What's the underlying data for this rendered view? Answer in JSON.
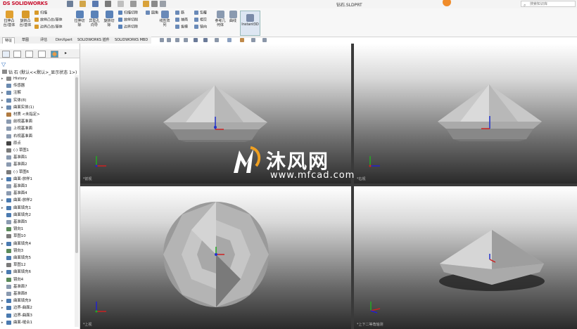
{
  "app": {
    "logo_ds": "DS",
    "logo_text": "SOLIDWORKS",
    "doc_title": "钻石.SLDPRT",
    "search_placeholder": "搜索知识库"
  },
  "ribbon": {
    "big_buttons": [
      {
        "label": "拉伸凸\n台/基体"
      },
      {
        "label": "旋转凸\n台/基体"
      },
      {
        "label": "拉伸切\n除"
      },
      {
        "label": "异型孔\n向导"
      },
      {
        "label": "旋转切\n除"
      },
      {
        "label": "线性阵\n列"
      },
      {
        "label": "参考几\n何体"
      },
      {
        "label": "曲线"
      },
      {
        "label": "Instant3D"
      }
    ],
    "small_buttons": [
      "扫描",
      "放样凸台/基体",
      "边界凸台/基体",
      "扫描切除",
      "放样切削",
      "边界切除",
      "圆角",
      "筋",
      "抽壳",
      "拔模",
      "包覆",
      "相交",
      "镜向"
    ]
  },
  "tabs": [
    "特征",
    "草图",
    "评估",
    "DimXpert",
    "SOLIDWORKS 插件",
    "SOLIDWORKS MBD"
  ],
  "tree": {
    "root": "钻 石 (默认<<默认>_显示状态 1>)",
    "items": [
      {
        "label": "History",
        "arrow": "▸",
        "color": "#8a8a8a"
      },
      {
        "label": "传感器",
        "arrow": "",
        "color": "#6a8ab0"
      },
      {
        "label": "注解",
        "arrow": "▸",
        "color": "#6a8ab0"
      },
      {
        "label": "实体(8)",
        "arrow": "▸",
        "color": "#6a8ab0"
      },
      {
        "label": "曲面实体(1)",
        "arrow": "▸",
        "color": "#6a8ab0"
      },
      {
        "label": "材质 <未指定>",
        "arrow": "",
        "color": "#b07a40"
      },
      {
        "label": "前视基准面",
        "arrow": "",
        "color": "#8a9ab0"
      },
      {
        "label": "上视基准面",
        "arrow": "",
        "color": "#8a9ab0"
      },
      {
        "label": "右视基准面",
        "arrow": "",
        "color": "#8a9ab0"
      },
      {
        "label": "原点",
        "arrow": "",
        "color": "#444444"
      },
      {
        "label": "(-) 草图1",
        "arrow": "",
        "color": "#7a7a7a"
      },
      {
        "label": "基准面1",
        "arrow": "",
        "color": "#8a9ab0"
      },
      {
        "label": "基准面2",
        "arrow": "",
        "color": "#8a9ab0"
      },
      {
        "label": "(-) 草图6",
        "arrow": "",
        "color": "#7a7a7a"
      },
      {
        "label": "曲面-放样1",
        "arrow": "▸",
        "color": "#4a7ab0"
      },
      {
        "label": "基准面3",
        "arrow": "",
        "color": "#8a9ab0"
      },
      {
        "label": "基准面4",
        "arrow": "",
        "color": "#8a9ab0"
      },
      {
        "label": "曲面-放样2",
        "arrow": "▸",
        "color": "#4a7ab0"
      },
      {
        "label": "曲面填充1",
        "arrow": "▸",
        "color": "#4a7ab0"
      },
      {
        "label": "曲面填充2",
        "arrow": "",
        "color": "#4a7ab0"
      },
      {
        "label": "基准面5",
        "arrow": "",
        "color": "#8a9ab0"
      },
      {
        "label": "镜向1",
        "arrow": "",
        "color": "#5a8a5a"
      },
      {
        "label": "草图10",
        "arrow": "",
        "color": "#7a7a7a"
      },
      {
        "label": "曲面填充4",
        "arrow": "▸",
        "color": "#4a7ab0"
      },
      {
        "label": "镜向3",
        "arrow": "",
        "color": "#5a8a5a"
      },
      {
        "label": "曲面填充5",
        "arrow": "",
        "color": "#4a7ab0"
      },
      {
        "label": "草图12",
        "arrow": "",
        "color": "#7a7a7a"
      },
      {
        "label": "曲面填充6",
        "arrow": "▸",
        "color": "#4a7ab0"
      },
      {
        "label": "镜向4",
        "arrow": "",
        "color": "#5a8a5a"
      },
      {
        "label": "基准面7",
        "arrow": "",
        "color": "#8a9ab0"
      },
      {
        "label": "基准面8",
        "arrow": "",
        "color": "#8a9ab0"
      },
      {
        "label": "曲面填充9",
        "arrow": "▸",
        "color": "#4a7ab0"
      },
      {
        "label": "边界-曲面2",
        "arrow": "▸",
        "color": "#4a7ab0"
      },
      {
        "label": "边界-曲面3",
        "arrow": "",
        "color": "#4a7ab0"
      },
      {
        "label": "曲面-缝合1",
        "arrow": "▸",
        "color": "#4a7ab0"
      }
    ]
  },
  "viewports": {
    "front": "*前视",
    "right": "*右视",
    "top": "*上视",
    "iso": "*上下二等角轴测"
  },
  "watermark": {
    "cn": "沐风网",
    "url": "www.mfcad.com"
  },
  "colors": {
    "accent": "#c8102e",
    "help": "#f08c2a",
    "gem": "#c8c8c8"
  }
}
